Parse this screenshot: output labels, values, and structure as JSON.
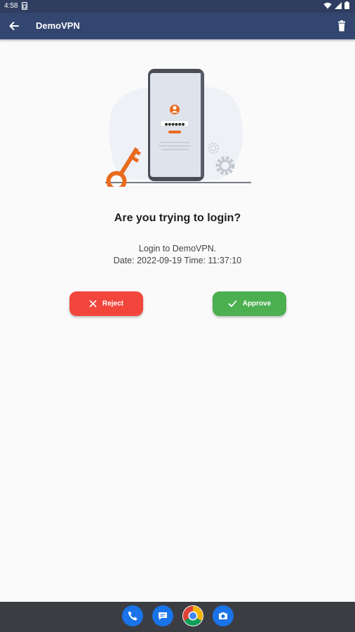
{
  "status_bar": {
    "time": "4:58",
    "icons": [
      "sim-icon",
      "wifi-icon",
      "signal-icon",
      "battery-icon"
    ]
  },
  "app_bar": {
    "title": "DemoVPN",
    "back_icon": "arrow-back-icon",
    "delete_icon": "trash-icon",
    "color": "#33466f"
  },
  "illustration": {
    "password_mask": "●●●●●●",
    "accent": "#e96b1f"
  },
  "prompt": {
    "question": "Are you trying to login?",
    "line1": "Login to DemoVPN.",
    "line2": "Date: 2022-09-19 Time: 11:37:10"
  },
  "actions": {
    "reject_label": "Reject",
    "reject_color": "#f2463c",
    "approve_label": "Approve",
    "approve_color": "#4caf50"
  },
  "dock": {
    "apps": [
      "phone-icon",
      "messages-icon",
      "chrome-icon",
      "camera-icon"
    ]
  }
}
